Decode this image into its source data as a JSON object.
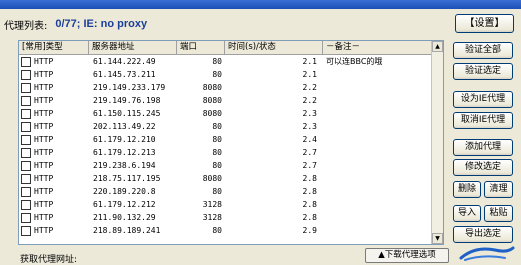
{
  "toolbar": {
    "list_label": "代理列表:",
    "status": "0/77;   IE: no proxy",
    "settings_button": "【设置】"
  },
  "table": {
    "columns": [
      "[常用]类型",
      "服务器地址",
      "端口",
      "时间(s)/状态",
      "－备注－"
    ],
    "rows": [
      {
        "type": "HTTP",
        "address": "61.144.222.49",
        "port": "80",
        "time": "2.1",
        "note": "可以连BBC的哦"
      },
      {
        "type": "HTTP",
        "address": "61.145.73.211",
        "port": "80",
        "time": "2.1",
        "note": ""
      },
      {
        "type": "HTTP",
        "address": "219.149.233.179",
        "port": "8080",
        "time": "2.2",
        "note": ""
      },
      {
        "type": "HTTP",
        "address": "219.149.76.198",
        "port": "8080",
        "time": "2.2",
        "note": ""
      },
      {
        "type": "HTTP",
        "address": "61.150.115.245",
        "port": "8080",
        "time": "2.3",
        "note": ""
      },
      {
        "type": "HTTP",
        "address": "202.113.49.22",
        "port": "80",
        "time": "2.3",
        "note": ""
      },
      {
        "type": "HTTP",
        "address": "61.179.12.210",
        "port": "80",
        "time": "2.4",
        "note": ""
      },
      {
        "type": "HTTP",
        "address": "61.179.12.213",
        "port": "80",
        "time": "2.7",
        "note": ""
      },
      {
        "type": "HTTP",
        "address": "219.238.6.194",
        "port": "80",
        "time": "2.7",
        "note": ""
      },
      {
        "type": "HTTP",
        "address": "218.75.117.195",
        "port": "8080",
        "time": "2.8",
        "note": ""
      },
      {
        "type": "HTTP",
        "address": "220.189.220.8",
        "port": "80",
        "time": "2.8",
        "note": ""
      },
      {
        "type": "HTTP",
        "address": "61.179.12.212",
        "port": "3128",
        "time": "2.8",
        "note": ""
      },
      {
        "type": "HTTP",
        "address": "211.90.132.29",
        "port": "3128",
        "time": "2.8",
        "note": ""
      },
      {
        "type": "HTTP",
        "address": "218.89.189.241",
        "port": "80",
        "time": "2.9",
        "note": ""
      }
    ]
  },
  "buttons": {
    "verify_all": "验证全部",
    "verify_selected": "验证选定",
    "set_ie_proxy": "设为IE代理",
    "cancel_ie_proxy": "取消IE代理",
    "add_proxy": "添加代理",
    "edit_selected": "修改选定",
    "delete": "删除",
    "clear": "清理",
    "import": "导入",
    "paste": "粘贴",
    "export_selected": "导出选定"
  },
  "bottom": {
    "fetch_label": "获取代理网址:",
    "download_button": "▲下载代理选项"
  },
  "colors": {
    "window_bg": "#ece9d8",
    "status_text": "#1b3f9b",
    "titlebar": "#1c4fb6"
  }
}
